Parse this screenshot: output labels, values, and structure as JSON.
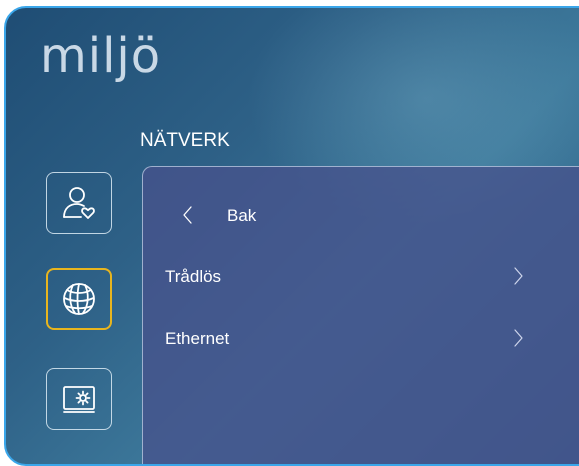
{
  "app": {
    "title": "miljö"
  },
  "section": {
    "title": "NÄTVERK"
  },
  "sidebar": {
    "items": [
      {
        "icon": "user-heart-icon",
        "active": false
      },
      {
        "icon": "globe-icon",
        "active": true
      },
      {
        "icon": "display-settings-icon",
        "active": false
      }
    ]
  },
  "menu": {
    "back_label": "Bak",
    "items": [
      {
        "label": "Trådlös"
      },
      {
        "label": "Ethernet"
      }
    ]
  },
  "colors": {
    "frame_border": "#3aa6ea",
    "active_border": "#e8b51e",
    "panel_bg": "#46528c"
  }
}
